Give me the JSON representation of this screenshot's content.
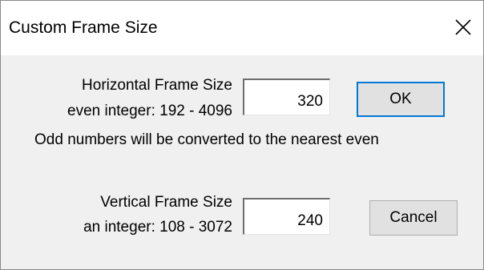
{
  "window": {
    "title": "Custom Frame Size",
    "close_icon": "close-icon"
  },
  "horizontal": {
    "label_line1": "Horizontal Frame Size",
    "label_line2": "even integer: 192 - 4096",
    "value": "320"
  },
  "note": "Odd numbers will be converted to the nearest even",
  "vertical": {
    "label_line1": "Vertical Frame Size",
    "label_line2": "an integer: 108 - 3072",
    "value": "240"
  },
  "buttons": {
    "ok_label": "OK",
    "cancel_label": "Cancel"
  },
  "colors": {
    "dialog_bg": "#f0f0f0",
    "titlebar_bg": "#ffffff",
    "default_button_border": "#0078d7"
  }
}
